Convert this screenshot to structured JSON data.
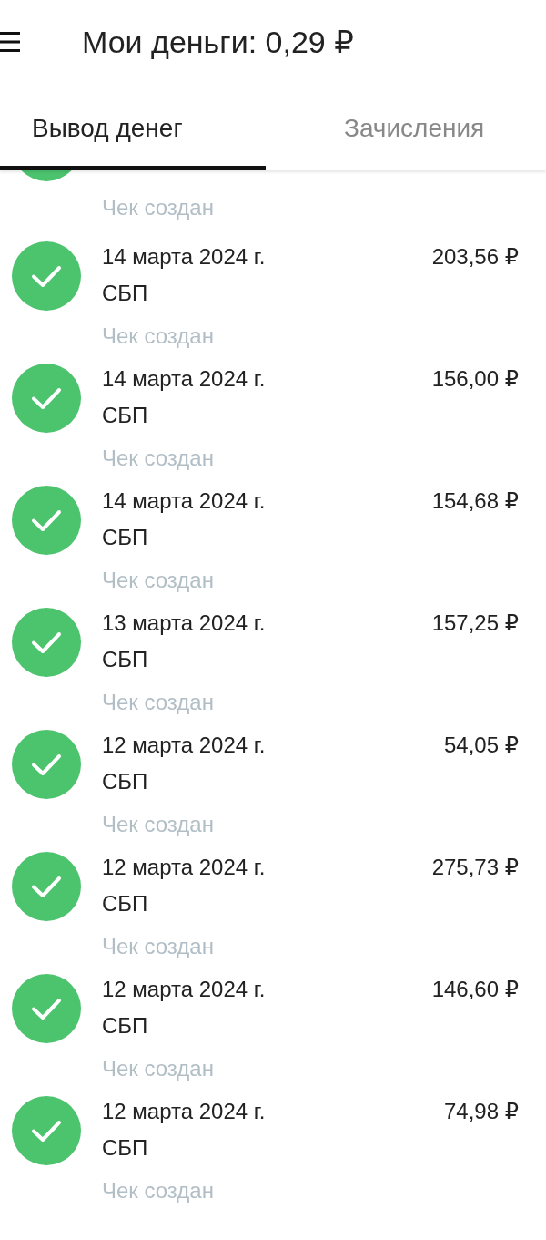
{
  "header": {
    "title": "Мои деньги: 0,29 ₽"
  },
  "tabs": [
    {
      "label": "Вывод денег",
      "selected": true
    },
    {
      "label": "Зачисления",
      "selected": false
    }
  ],
  "clipped_entry": {
    "status": "Чек создан"
  },
  "withdrawals": [
    {
      "date": "14 марта 2024 г.",
      "method": "СБП",
      "amount": "203,56 ₽",
      "status": "Чек создан"
    },
    {
      "date": "14 марта 2024 г.",
      "method": "СБП",
      "amount": "156,00 ₽",
      "status": "Чек создан"
    },
    {
      "date": "14 марта 2024 г.",
      "method": "СБП",
      "amount": "154,68 ₽",
      "status": "Чек создан"
    },
    {
      "date": "13 марта 2024 г.",
      "method": "СБП",
      "amount": "157,25 ₽",
      "status": "Чек создан"
    },
    {
      "date": "12 марта 2024 г.",
      "method": "СБП",
      "amount": "54,05 ₽",
      "status": "Чек создан"
    },
    {
      "date": "12 марта 2024 г.",
      "method": "СБП",
      "amount": "275,73 ₽",
      "status": "Чек создан"
    },
    {
      "date": "12 марта 2024 г.",
      "method": "СБП",
      "amount": "146,60 ₽",
      "status": "Чек создан"
    },
    {
      "date": "12 марта 2024 г.",
      "method": "СБП",
      "amount": "74,98 ₽",
      "status": "Чек создан"
    }
  ]
}
